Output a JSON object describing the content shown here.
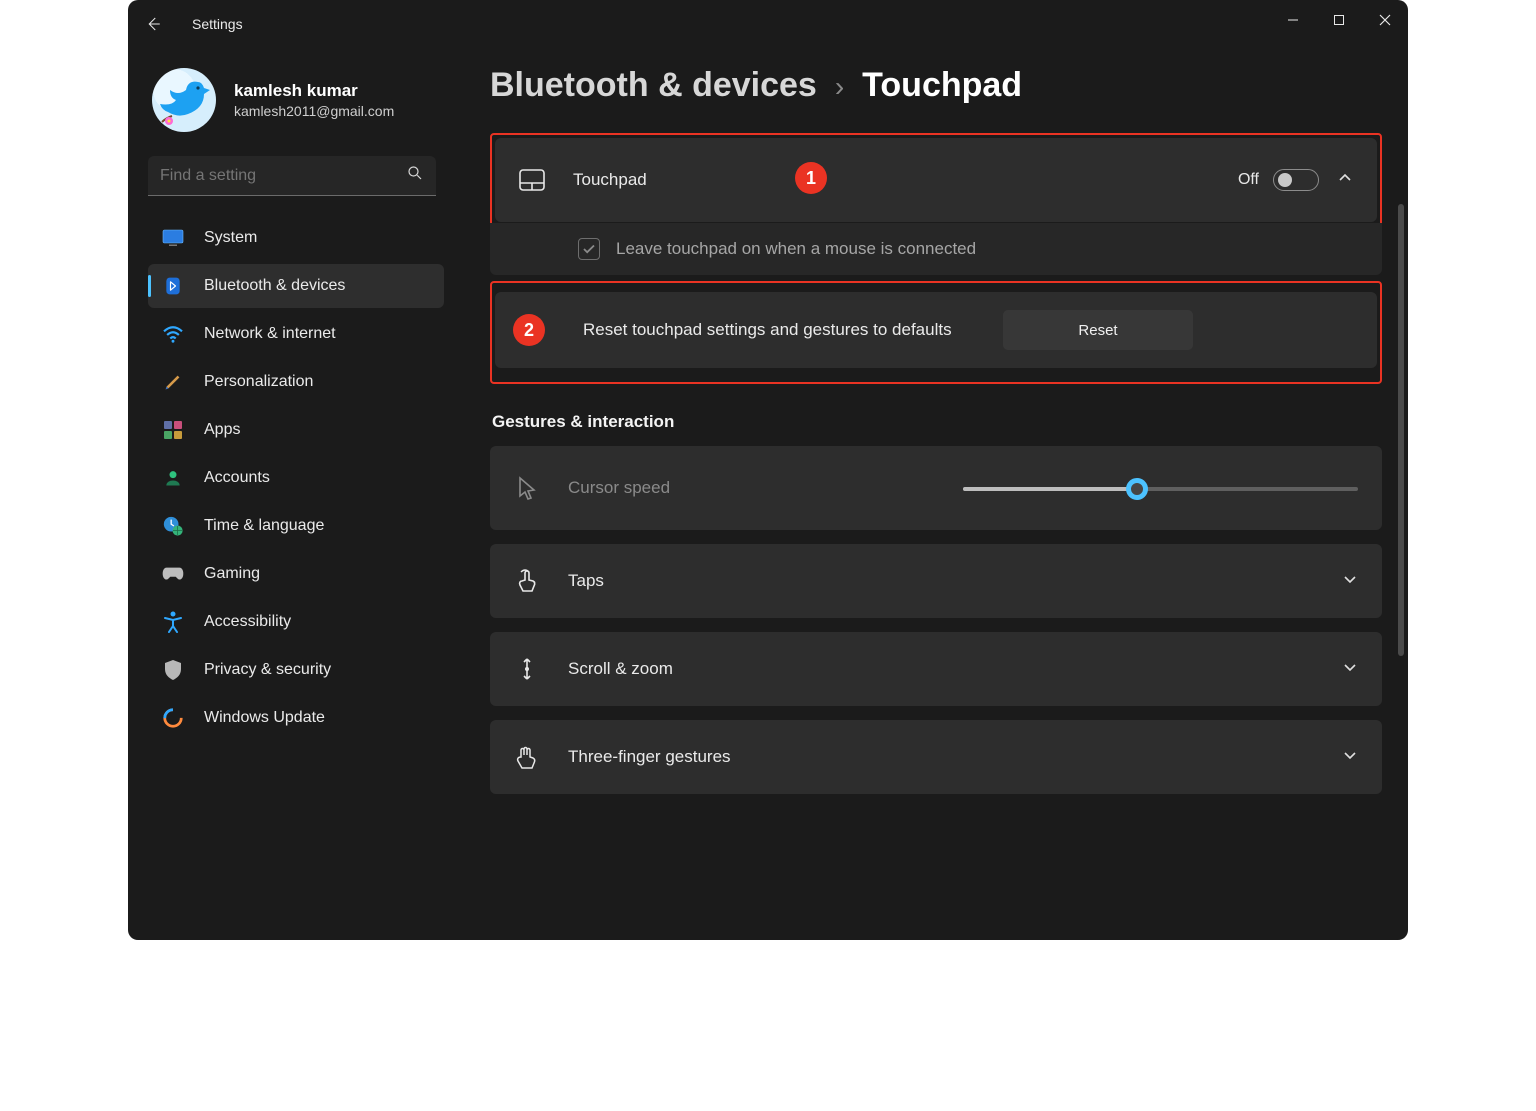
{
  "window": {
    "title": "Settings"
  },
  "user": {
    "name": "kamlesh kumar",
    "email": "kamlesh2011@gmail.com"
  },
  "search": {
    "placeholder": "Find a setting"
  },
  "sidebar": {
    "items": [
      {
        "label": "System"
      },
      {
        "label": "Bluetooth & devices"
      },
      {
        "label": "Network & internet"
      },
      {
        "label": "Personalization"
      },
      {
        "label": "Apps"
      },
      {
        "label": "Accounts"
      },
      {
        "label": "Time & language"
      },
      {
        "label": "Gaming"
      },
      {
        "label": "Accessibility"
      },
      {
        "label": "Privacy & security"
      },
      {
        "label": "Windows Update"
      }
    ]
  },
  "breadcrumb": {
    "parent": "Bluetooth & devices",
    "sep": "›",
    "current": "Touchpad"
  },
  "touchpad": {
    "label": "Touchpad",
    "toggle_state": "Off",
    "leave_on_mouse": "Leave touchpad on when a mouse is connected",
    "reset_label": "Reset touchpad settings and gestures to defaults",
    "reset_button": "Reset"
  },
  "gestures": {
    "header": "Gestures & interaction",
    "cursor_speed": "Cursor speed",
    "taps": "Taps",
    "scroll_zoom": "Scroll & zoom",
    "three_finger": "Three-finger gestures",
    "slider_percent": 44
  },
  "annotations": {
    "one": "1",
    "two": "2"
  }
}
